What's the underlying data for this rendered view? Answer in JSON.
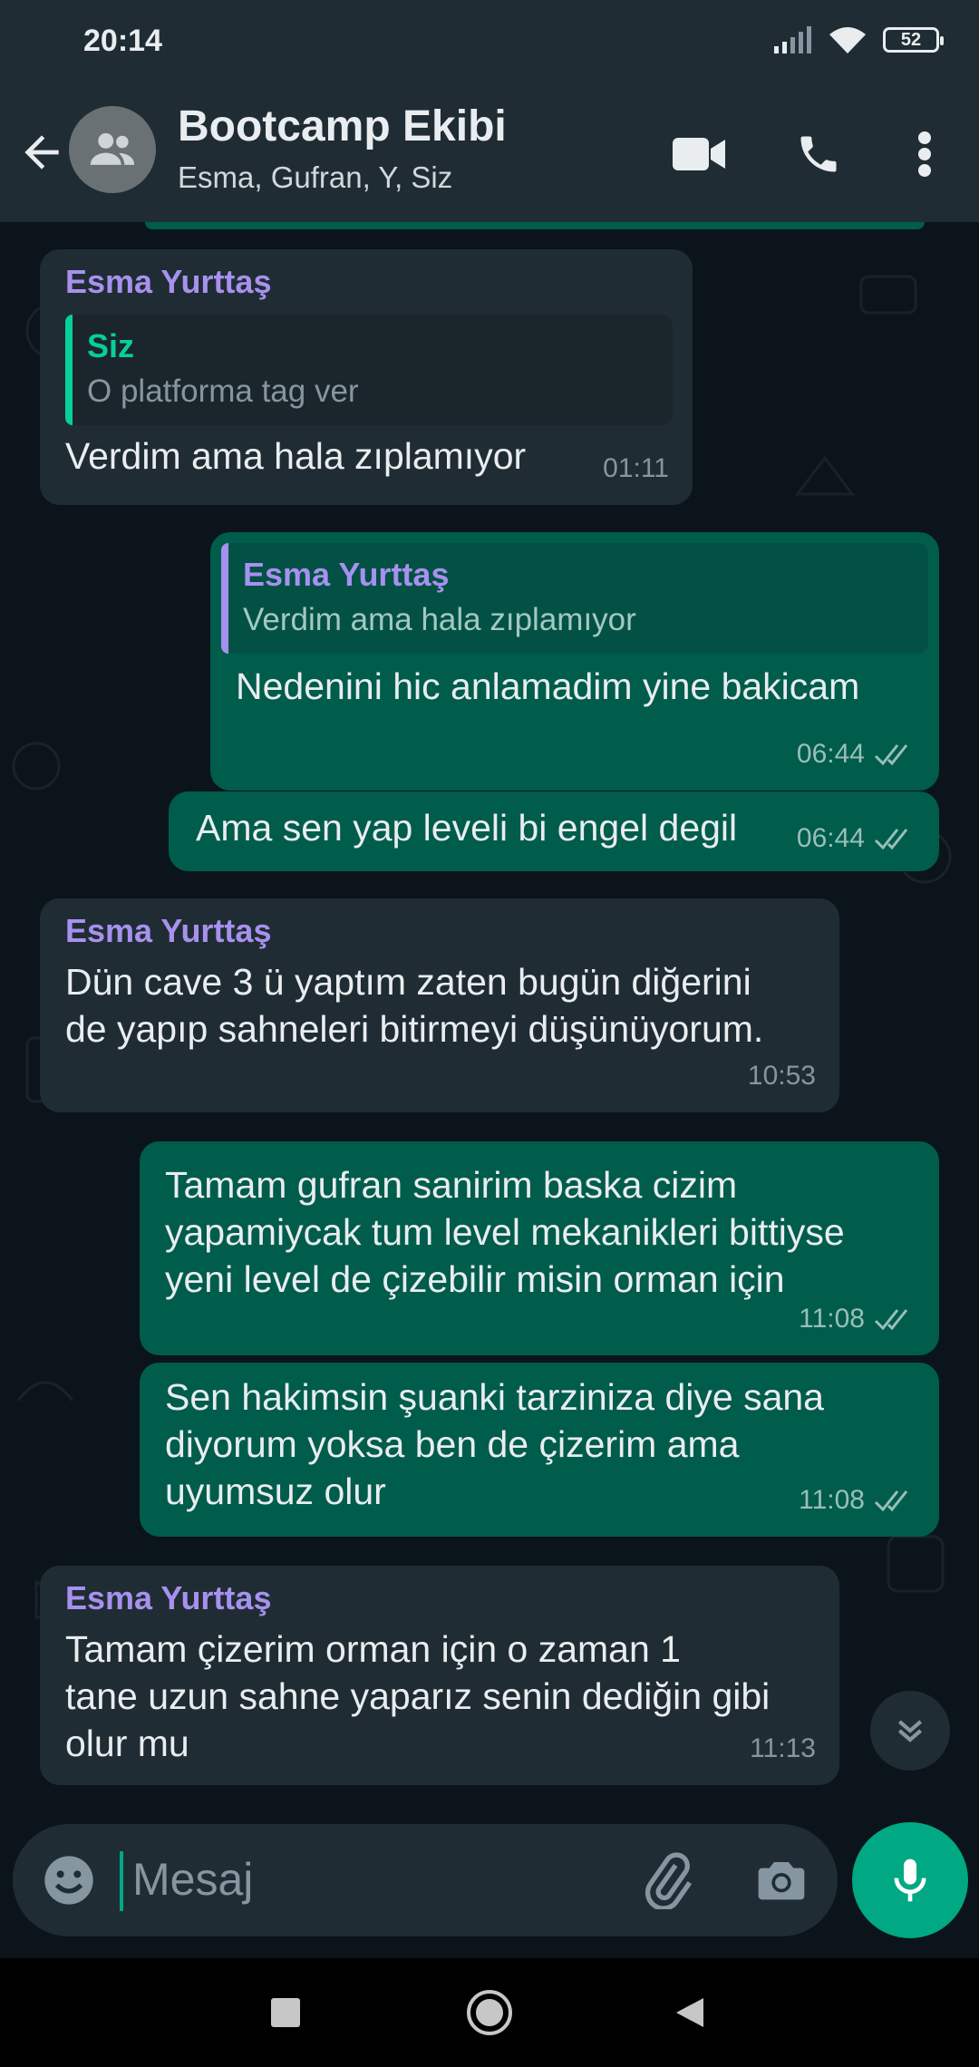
{
  "status_bar": {
    "time": "20:14",
    "battery": "52"
  },
  "header": {
    "title": "Bootcamp Ekibi",
    "subtitle": "Esma, Gufran, Y, Siz"
  },
  "messages": [
    {
      "direction": "in",
      "sender": "Esma Yurttaş",
      "quote_name": "Siz",
      "quote_text": "O platforma tag ver",
      "text": "Verdim ama hala zıplamıyor",
      "time": "01:11"
    },
    {
      "direction": "out",
      "quote_name": "Esma Yurttaş",
      "quote_text": "Verdim ama hala zıplamıyor",
      "text": "Nedenini hic anlamadim yine bakicam",
      "time": "06:44"
    },
    {
      "direction": "out",
      "text": "Ama sen yap leveli bi engel degil",
      "time": "06:44"
    },
    {
      "direction": "in",
      "sender": "Esma Yurttaş",
      "text": "Dün cave 3 ü yaptım zaten bugün diğerini\nde yapıp sahneleri bitirmeyi düşünüyorum.",
      "time": "10:53"
    },
    {
      "direction": "out",
      "text": "Tamam gufran sanirim baska cizim\nyapamiycak tum level mekanikleri bittiyse\nyeni level de çizebilir misin orman için",
      "time": "11:08"
    },
    {
      "direction": "out",
      "text": "Sen hakimsin şuanki tarziniza diye sana\ndiyorum yoksa ben de çizerim ama\nuyumsuz olur",
      "time": "11:08"
    },
    {
      "direction": "in",
      "sender": "Esma Yurttaş",
      "text": "Tamam çizerim orman için o zaman 1\ntane uzun sahne yaparız senin dediğin gibi\nolur mu",
      "time": "11:13"
    }
  ],
  "composer": {
    "placeholder": "Mesaj"
  },
  "colors": {
    "incoming": "#202c33",
    "outgoing": "#005c4b",
    "accent": "#00a884",
    "sender": "#a791ef"
  }
}
